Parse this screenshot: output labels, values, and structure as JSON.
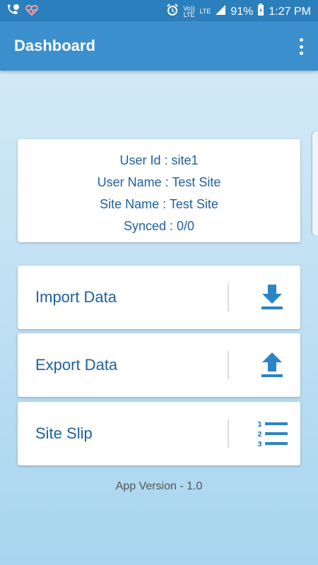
{
  "status_bar": {
    "battery": "91%",
    "time": "1:27 PM",
    "volte_label": "Vo)) LTE",
    "lte_label": "LTE",
    "icons": [
      "phone-hd-icon",
      "heart-monitor-icon",
      "alarm-icon",
      "signal-icon",
      "battery-charging-icon"
    ]
  },
  "app_bar": {
    "title": "Dashboard"
  },
  "info": {
    "user_id": "User Id : site1",
    "user_name": "User Name : Test Site",
    "site_name": "Site Name : Test Site",
    "synced": "Synced : 0/0"
  },
  "actions": [
    {
      "label": "Import Data",
      "icon": "download-icon"
    },
    {
      "label": "Export Data",
      "icon": "upload-icon"
    },
    {
      "label": "Site Slip",
      "icon": "numbered-list-icon"
    }
  ],
  "footer": {
    "version": "App Version - 1.0"
  },
  "colors": {
    "status_bar": "#2b7fbd",
    "app_bar": "#3b8fcd",
    "text_accent": "#1f5f9e",
    "icon_accent": "#2a84c6"
  }
}
